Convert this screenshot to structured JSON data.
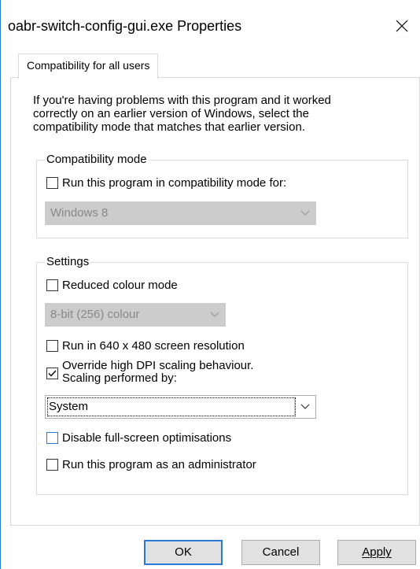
{
  "window": {
    "title": "oabr-switch-config-gui.exe Properties"
  },
  "tabs": [
    {
      "label": "Compatibility for all users",
      "active": true
    }
  ],
  "intro": {
    "lines": [
      "If you're having problems with this program and it worked",
      "correctly on an earlier version of Windows, select the",
      "compatibility mode that matches that earlier version."
    ]
  },
  "compat_mode": {
    "title": "Compatibility mode",
    "checkbox": {
      "label": "Run this program in compatibility mode for:",
      "checked": false
    },
    "select": {
      "value": "Windows 8",
      "enabled": false
    }
  },
  "settings": {
    "title": "Settings",
    "reduced_colour": {
      "label": "Reduced colour mode",
      "checked": false
    },
    "colour_select": {
      "value": "8-bit (256) colour",
      "enabled": false
    },
    "resolution": {
      "label": "Run in 640 x 480 screen resolution",
      "checked": false
    },
    "dpi": {
      "label_line1": "Override high DPI scaling behaviour.",
      "label_line2": "Scaling performed by:",
      "checked": true
    },
    "dpi_select": {
      "value": "System",
      "enabled": true
    },
    "fullscreen": {
      "label": "Disable full-screen optimisations",
      "checked": false
    },
    "admin": {
      "label": "Run this program as an administrator",
      "checked": false
    }
  },
  "buttons": {
    "ok": "OK",
    "cancel": "Cancel",
    "apply": "Apply"
  },
  "colors": {
    "accent": "#2b79d6",
    "disabled_field": "#cccccc",
    "border": "#dcdcdc"
  }
}
